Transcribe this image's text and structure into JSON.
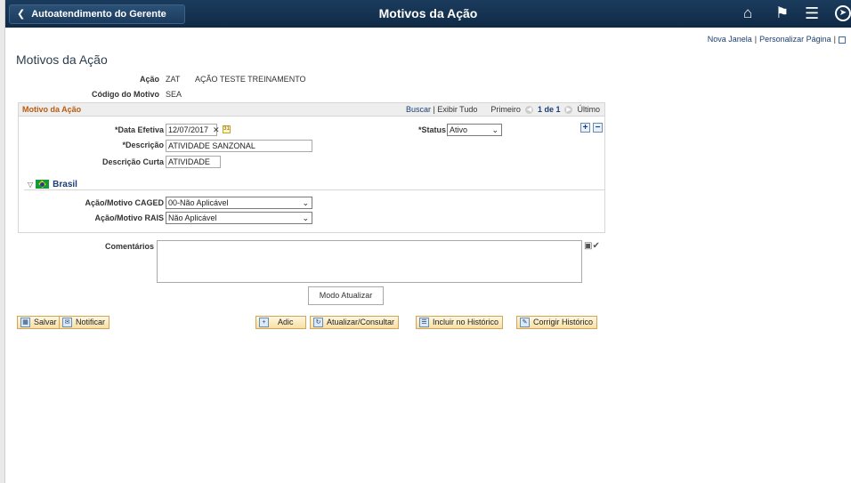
{
  "header": {
    "back_label": "Autoatendimento do Gerente",
    "title": "Motivos da Ação",
    "icons": [
      "home-icon",
      "flag-icon",
      "menu-icon",
      "compass-icon"
    ]
  },
  "top_links": {
    "new_window": "Nova Janela",
    "personalize": "Personalizar Página"
  },
  "page_title": "Motivos da Ação",
  "summary": {
    "acao_label": "Ação",
    "acao_code": "ZAT",
    "acao_desc": "AÇÃO TESTE TREINAMENTO",
    "codigo_label": "Código do Motivo",
    "codigo_value": "SEA"
  },
  "grid": {
    "title": "Motivo da Ação",
    "find": "Buscar",
    "view_all": "Exibir Tudo",
    "first": "Primeiro",
    "count": "1 de 1",
    "last": "Último",
    "data_efetiva_label": "*Data Efetiva",
    "data_efetiva_value": "12/07/2017",
    "status_label": "*Status",
    "status_value": "Ativo",
    "descricao_label": "*Descrição",
    "descricao_value": "ATIVIDADE SANZONAL",
    "descr_curta_label": "Descrição Curta",
    "descr_curta_value": "ATIVIDADE",
    "country": "Brasil",
    "caged_label": "Ação/Motivo CAGED",
    "caged_value": "00-Não Aplicável",
    "rais_label": "Ação/Motivo RAIS",
    "rais_value": "Não Aplicável"
  },
  "comments_label": "Comentários",
  "mode_label": "Modo Atualizar",
  "toolbar": {
    "save": "Salvar",
    "notify": "Notificar",
    "add": "Adic",
    "update": "Atualizar/Consultar",
    "include_history": "Incluir no Histórico",
    "correct_history": "Corrigir Histórico"
  },
  "colors": {
    "header_bg": "#0f2a46",
    "section_title": "#b85c12",
    "link": "#1a3e73"
  }
}
